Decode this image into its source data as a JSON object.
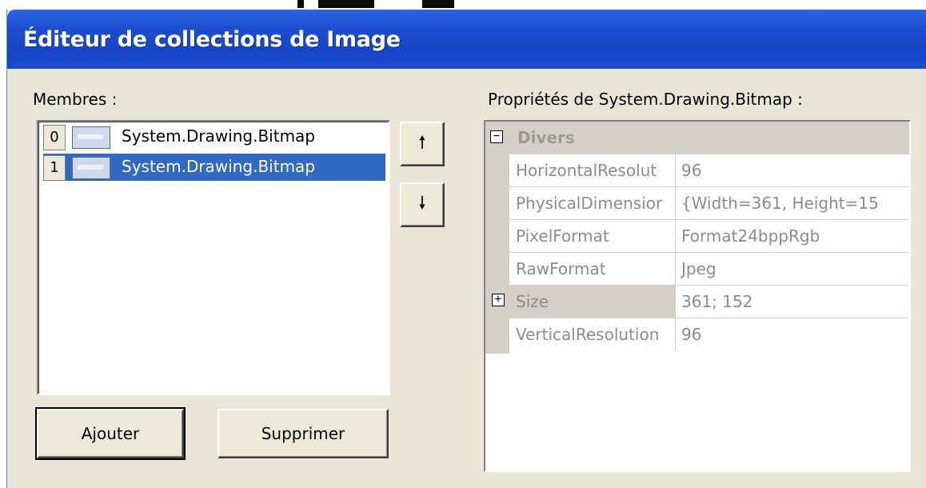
{
  "window": {
    "title": "Éditeur de collections de Image"
  },
  "members": {
    "label": "Membres :",
    "items": [
      {
        "index": "0",
        "name": "System.Drawing.Bitmap",
        "selected": false
      },
      {
        "index": "1",
        "name": "System.Drawing.Bitmap",
        "selected": true
      }
    ],
    "move_up_glyph": "🠕",
    "move_down_glyph": "🠗",
    "add_label": "Ajouter",
    "remove_label": "Supprimer"
  },
  "properties": {
    "label": "Propriétés de System.Drawing.Bitmap :",
    "category": {
      "name": "Divers",
      "expander": "−"
    },
    "rows": [
      {
        "name": "HorizontalResolut",
        "value": "96"
      },
      {
        "name": "PhysicalDimensior",
        "value": "{Width=361, Height=15"
      },
      {
        "name": "PixelFormat",
        "value": "Format24bppRgb"
      },
      {
        "name": "RawFormat",
        "value": "Jpeg"
      },
      {
        "name": "Size",
        "value": "361; 152",
        "expander": "+"
      },
      {
        "name": "VerticalResolution",
        "value": "96"
      }
    ]
  },
  "colors": {
    "titlebar": "#1d4fd0",
    "selection": "#316ac5",
    "dialog_bg": "#e9e6d8"
  }
}
